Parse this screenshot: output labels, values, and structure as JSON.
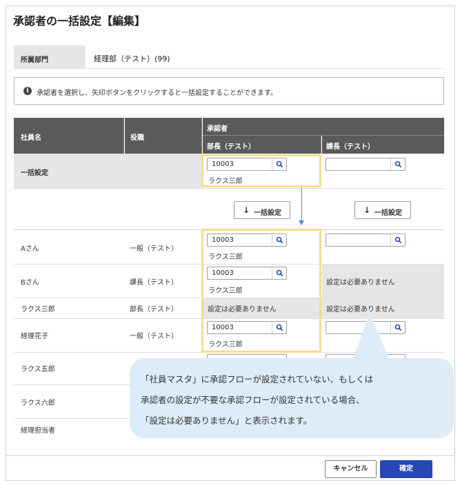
{
  "dialog": {
    "title": "承認者の一括設定【編集】"
  },
  "dept": {
    "label": "所属部門",
    "value": "経理部（テスト）(99)"
  },
  "info": {
    "text": "承認者を選択し、矢印ボタンをクリックすると一括設定することができます。"
  },
  "table": {
    "col_employee": "社員名",
    "col_position": "役職",
    "col_approver": "承認者",
    "col_approver_1": "部長（テスト）",
    "col_approver_2": "課長（テスト）",
    "bulk_row_label": "一括設定",
    "bulk_input_1": "10003",
    "bulk_name_1": "ラクス三郎",
    "bulk_button_1": "一括設定",
    "bulk_button_2": "一括設定",
    "rows": [
      {
        "name": "Aさん",
        "position": "一般（テスト）",
        "input": "10003",
        "approver_name": "ラクス三郎"
      },
      {
        "name": "Bさん",
        "position": "課長（テスト）",
        "input": "10003",
        "approver_name": "ラクス三郎",
        "col2_text": "設定は必要ありません"
      },
      {
        "name": "ラクス三郎",
        "position": "部長（テスト）",
        "col1_text": "設定は必要ありません",
        "col2_text": "設定は必要ありません"
      },
      {
        "name": "経理花子",
        "position": "一般（テスト）",
        "input": "10003",
        "approver_name": "ラクス三郎"
      },
      {
        "name": "ラクス五郎"
      },
      {
        "name": "ラクス六郎"
      },
      {
        "name": "経理担当者"
      }
    ]
  },
  "callout": {
    "line1": "「社員マスタ」に承認フローが設定されていない、もしくは",
    "line2": "承認者の設定が不要な承認フローが設定されている場合、",
    "line3": "「設定は必要ありません」と表示されます。"
  },
  "footer": {
    "cancel_label": "キャンセル",
    "ok_label": "確定"
  },
  "icons": {
    "search": "search-icon",
    "info": "info-icon",
    "down_arrow": "arrow-down-icon"
  },
  "colors": {
    "header_bg": "#5a5a5a",
    "highlight": "#f4df8a",
    "callout_bg": "#dcecf8",
    "primary": "#2747b7",
    "connector": "#4a90d6"
  }
}
